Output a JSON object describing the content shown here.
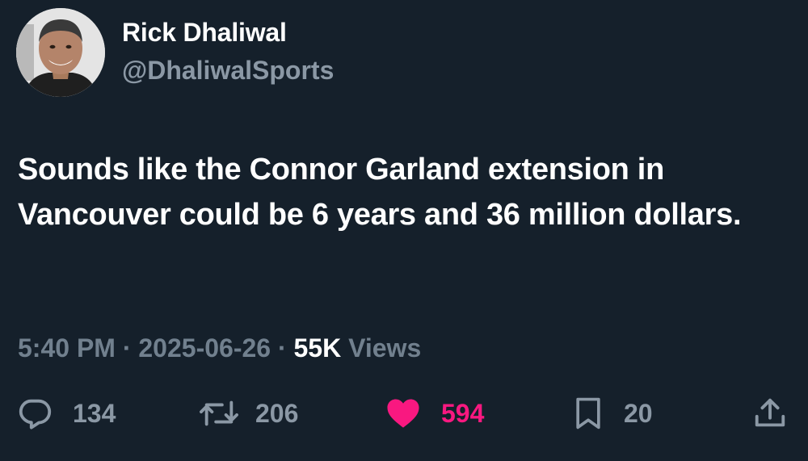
{
  "author": {
    "name": "Rick Dhaliwal",
    "handle": "@DhaliwalSports",
    "avatar_icon": "profile-photo"
  },
  "tweet": {
    "text": "Sounds like the Connor Garland extension in Vancouver could be 6 years and 36 million dollars."
  },
  "meta": {
    "time": "5:40 PM",
    "separator": "·",
    "date": "2025-06-26",
    "views_count": "55K",
    "views_label": "Views"
  },
  "actions": {
    "replies": {
      "icon": "reply-icon",
      "count": "134"
    },
    "retweets": {
      "icon": "retweet-icon",
      "count": "206"
    },
    "likes": {
      "icon": "heart-icon",
      "count": "594",
      "liked": true
    },
    "bookmarks": {
      "icon": "bookmark-icon",
      "count": "20"
    },
    "share": {
      "icon": "share-icon"
    }
  },
  "colors": {
    "background": "#15202b",
    "primary_text": "#ffffff",
    "secondary_text": "#8b98a5",
    "like_accent": "#f91880"
  }
}
